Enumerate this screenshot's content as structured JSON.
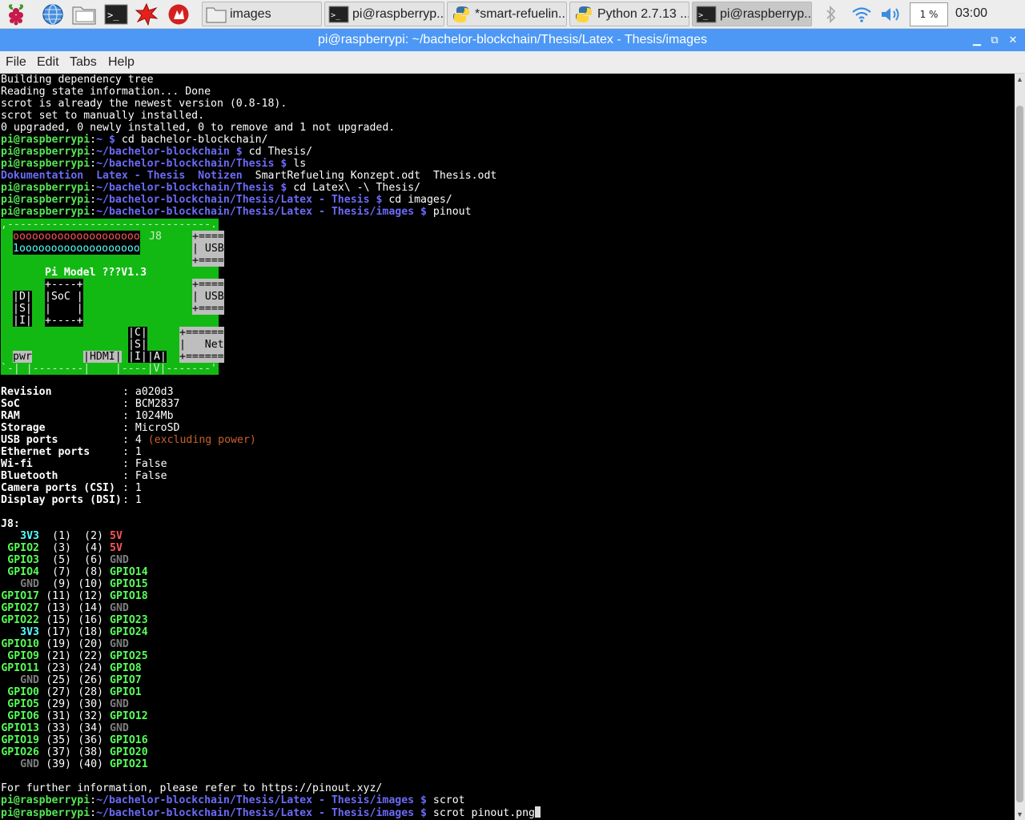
{
  "taskbar": {
    "launchers": [
      "raspberry-menu-icon",
      "web-browser-icon",
      "file-manager-icon",
      "terminal-icon",
      "mathematica-icon",
      "wolfram-icon"
    ],
    "tasks": [
      {
        "label": "images",
        "icon": "folder-icon"
      },
      {
        "label": "pi@raspberryp...",
        "icon": "terminal-icon"
      },
      {
        "label": "*smart-refuelin...",
        "icon": "python-icon"
      },
      {
        "label": "Python 2.7.13 ...",
        "icon": "python-icon"
      },
      {
        "label": "pi@raspberryp...",
        "icon": "terminal-icon"
      }
    ],
    "cpu": "1 %",
    "clock": "03:00"
  },
  "window": {
    "title": "pi@raspberrypi: ~/bachelor-blockchain/Thesis/Latex - Thesis/images",
    "controls": {
      "minimize": "▁",
      "maximize": "⧉",
      "close": "✕"
    }
  },
  "menu": [
    "File",
    "Edit",
    "Tabs",
    "Help"
  ],
  "terminal": {
    "prompt_user": "pi@raspberrypi",
    "prompt_sep": ":",
    "prompt_dollar": " $ ",
    "lines_before": [
      "Building dependency tree",
      "Reading state information... Done",
      "scrot is already the newest version (0.8-18).",
      "scrot set to manually installed.",
      "0 upgraded, 0 newly installed, 0 to remove and 1 not upgraded."
    ],
    "commands": [
      {
        "path": "~",
        "cmd": "cd bachelor-blockchain/"
      },
      {
        "path": "~/bachelor-blockchain",
        "cmd": "cd Thesis/"
      },
      {
        "path": "~/bachelor-blockchain/Thesis",
        "cmd": "ls"
      }
    ],
    "ls_output": {
      "dirs": [
        "Dokumentation",
        "Latex - Thesis",
        "Notizen"
      ],
      "files": [
        "SmartRefueling Konzept.odt",
        "Thesis.odt"
      ]
    },
    "commands2": [
      {
        "path": "~/bachelor-blockchain/Thesis",
        "cmd": "cd Latex\\ -\\ Thesis/"
      },
      {
        "path": "~/bachelor-blockchain/Thesis/Latex - Thesis",
        "cmd": "cd images/"
      },
      {
        "path": "~/bachelor-blockchain/Thesis/Latex - Thesis/images",
        "cmd": "pinout"
      }
    ],
    "board": {
      "top_border": ",--------------------------------.",
      "header_row1": "oooooooooooooooooooo",
      "header_row2": "1ooooooooooooooooooo",
      "j8": "J8",
      "usb1": [
        "+====",
        "| USB",
        "+===="
      ],
      "model": "Pi Model ???V1.3",
      "soc": [
        "+----+",
        "|SoC |",
        "|    |",
        "+----+"
      ],
      "usb2": [
        "+====",
        "| USB",
        "+===="
      ],
      "dsi": [
        "|D|",
        "|S|",
        "|I|"
      ],
      "csi": [
        "|C|",
        "|S|",
        "|I|"
      ],
      "net": [
        "+======",
        "|   Net",
        "+======"
      ],
      "pwr": "pwr",
      "hdmi": "|HDMI|",
      "av": [
        "|A|",
        "|V|"
      ],
      "bottom": "`-| |--------|    |----|V|-------'"
    },
    "info": [
      {
        "key": "Revision",
        "value": "a020d3",
        "extra": ""
      },
      {
        "key": "SoC",
        "value": "BCM2837",
        "extra": ""
      },
      {
        "key": "RAM",
        "value": "1024Mb",
        "extra": ""
      },
      {
        "key": "Storage",
        "value": "MicroSD",
        "extra": ""
      },
      {
        "key": "USB ports",
        "value": "4",
        "extra": "(excluding power)"
      },
      {
        "key": "Ethernet ports",
        "value": "1",
        "extra": ""
      },
      {
        "key": "Wi-fi",
        "value": "False",
        "extra": ""
      },
      {
        "key": "Bluetooth",
        "value": "False",
        "extra": ""
      },
      {
        "key": "Camera ports (CSI)",
        "value": "1",
        "extra": ""
      },
      {
        "key": "Display ports (DSI)",
        "value": "1",
        "extra": ""
      }
    ],
    "j8_label": "J8:",
    "pins": [
      {
        "l": "3V3",
        "lc": "gcy",
        "a": "(1)",
        "b": "(2)",
        "r": "5V",
        "rc": "g5v"
      },
      {
        "l": "GPIO2",
        "lc": "ggr",
        "a": "(3)",
        "b": "(4)",
        "r": "5V",
        "rc": "g5v"
      },
      {
        "l": "GPIO3",
        "lc": "ggr",
        "a": "(5)",
        "b": "(6)",
        "r": "GND",
        "rc": "ggnd"
      },
      {
        "l": "GPIO4",
        "lc": "ggr",
        "a": "(7)",
        "b": "(8)",
        "r": "GPIO14",
        "rc": "ggr"
      },
      {
        "l": "GND",
        "lc": "ggnd",
        "a": "(9)",
        "b": "(10)",
        "r": "GPIO15",
        "rc": "ggr"
      },
      {
        "l": "GPIO17",
        "lc": "ggr",
        "a": "(11)",
        "b": "(12)",
        "r": "GPIO18",
        "rc": "ggr"
      },
      {
        "l": "GPIO27",
        "lc": "ggr",
        "a": "(13)",
        "b": "(14)",
        "r": "GND",
        "rc": "ggnd"
      },
      {
        "l": "GPIO22",
        "lc": "ggr",
        "a": "(15)",
        "b": "(16)",
        "r": "GPIO23",
        "rc": "ggr"
      },
      {
        "l": "3V3",
        "lc": "gcy",
        "a": "(17)",
        "b": "(18)",
        "r": "GPIO24",
        "rc": "ggr"
      },
      {
        "l": "GPIO10",
        "lc": "ggr",
        "a": "(19)",
        "b": "(20)",
        "r": "GND",
        "rc": "ggnd"
      },
      {
        "l": "GPIO9",
        "lc": "ggr",
        "a": "(21)",
        "b": "(22)",
        "r": "GPIO25",
        "rc": "ggr"
      },
      {
        "l": "GPIO11",
        "lc": "ggr",
        "a": "(23)",
        "b": "(24)",
        "r": "GPIO8",
        "rc": "ggr"
      },
      {
        "l": "GND",
        "lc": "ggnd",
        "a": "(25)",
        "b": "(26)",
        "r": "GPIO7",
        "rc": "ggr"
      },
      {
        "l": "GPIO0",
        "lc": "ggr",
        "a": "(27)",
        "b": "(28)",
        "r": "GPIO1",
        "rc": "ggr"
      },
      {
        "l": "GPIO5",
        "lc": "ggr",
        "a": "(29)",
        "b": "(30)",
        "r": "GND",
        "rc": "ggnd"
      },
      {
        "l": "GPIO6",
        "lc": "ggr",
        "a": "(31)",
        "b": "(32)",
        "r": "GPIO12",
        "rc": "ggr"
      },
      {
        "l": "GPIO13",
        "lc": "ggr",
        "a": "(33)",
        "b": "(34)",
        "r": "GND",
        "rc": "ggnd"
      },
      {
        "l": "GPIO19",
        "lc": "ggr",
        "a": "(35)",
        "b": "(36)",
        "r": "GPIO16",
        "rc": "ggr"
      },
      {
        "l": "GPIO26",
        "lc": "ggr",
        "a": "(37)",
        "b": "(38)",
        "r": "GPIO20",
        "rc": "ggr"
      },
      {
        "l": "GND",
        "lc": "ggnd",
        "a": "(39)",
        "b": "(40)",
        "r": "GPIO21",
        "rc": "ggr"
      }
    ],
    "further_info": "For further information, please refer to https://pinout.xyz/",
    "final_commands": [
      {
        "path": "~/bachelor-blockchain/Thesis/Latex - Thesis/images",
        "cmd": "scrot"
      },
      {
        "path": "~/bachelor-blockchain/Thesis/Latex - Thesis/images",
        "cmd": "scrot pinout.png"
      }
    ]
  },
  "colors": {
    "titlebar": "#4d98f5",
    "prompt_green": "#55e655",
    "prompt_blue": "#6b6bf7",
    "board_green": "#13b913",
    "pin_red": "#ff5555",
    "pin_cyan": "#55ffff",
    "pin_gray": "#7f7f7f"
  }
}
